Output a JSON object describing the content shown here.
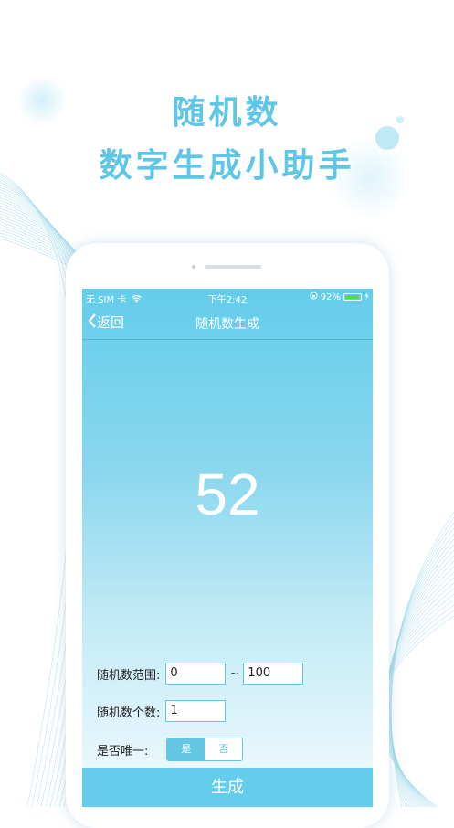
{
  "promo": {
    "title": "随机数",
    "subtitle": "数字生成小助手"
  },
  "status_bar": {
    "carrier": "无 SIM 卡",
    "time": "下午2:42",
    "battery_text": "92%",
    "battery_level": 0.92
  },
  "nav": {
    "back_label": "返回",
    "title": "随机数生成"
  },
  "result": "52",
  "form": {
    "range_label": "随机数范围:",
    "range_min": "0",
    "range_sep": "~",
    "range_max": "100",
    "count_label": "随机数个数:",
    "count_value": "1",
    "unique_label": "是否唯一:",
    "unique_yes": "是",
    "unique_no": "否"
  },
  "generate_label": "生成",
  "colors": {
    "accent": "#5ec6e6",
    "button": "#63cdeb",
    "battery": "#4cd964"
  }
}
